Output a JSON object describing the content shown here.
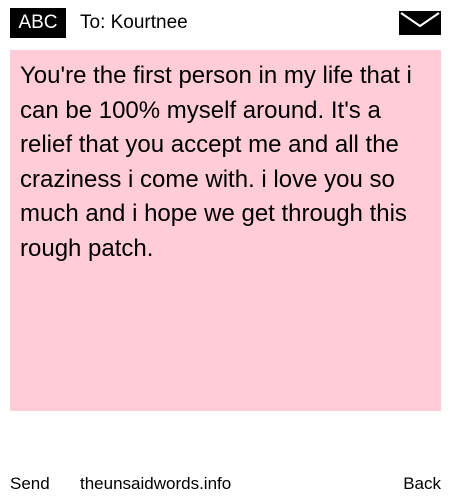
{
  "header": {
    "badge_label": "ABC",
    "to_label": "To: Kourtnee",
    "mail_icon": "envelope-icon"
  },
  "message": {
    "text": "You're the first person in my life that i can be 100% myself around. It's a relief that you accept me and all the craziness i come with. i love you so much and i hope we get through this rough patch.",
    "background_color": "#ffccd7"
  },
  "footer": {
    "send_label": "Send",
    "site_label": "theunsaidwords.info",
    "back_label": "Back"
  }
}
